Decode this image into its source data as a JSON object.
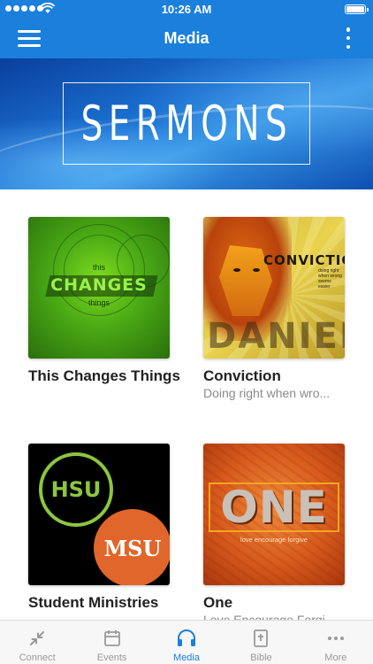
{
  "status_bar": {
    "time": "10:26 AM"
  },
  "header": {
    "title": "Media"
  },
  "banner": {
    "text": "SERMONS"
  },
  "series": [
    {
      "title": "This Changes Things",
      "subtitle": "",
      "art": {
        "line1": "this",
        "line2": "CHANGES",
        "line3": "things"
      }
    },
    {
      "title": "Conviction",
      "subtitle": "Doing right when wro...",
      "art": {
        "word": "CONVICTION",
        "tagline": "doing right when wrong seems easier",
        "overlay": "DANIEL"
      }
    },
    {
      "title": "Student Ministries",
      "subtitle": "",
      "art": {
        "left": "HSU",
        "right": "MSU"
      }
    },
    {
      "title": "One",
      "subtitle": "Love Encourage Forgi...",
      "art": {
        "word": "ONE",
        "tagline": "love  encourage  forgive"
      }
    }
  ],
  "tabs": [
    {
      "label": "Connect",
      "icon": "connect-arrows-icon",
      "active": false
    },
    {
      "label": "Events",
      "icon": "calendar-icon",
      "active": false
    },
    {
      "label": "Media",
      "icon": "headphones-icon",
      "active": true
    },
    {
      "label": "Bible",
      "icon": "bible-icon",
      "active": false
    },
    {
      "label": "More",
      "icon": "more-dots-icon",
      "active": false
    }
  ],
  "colors": {
    "accent": "#1b7fdc",
    "inactive": "#999999",
    "hsu_green": "#8cc63f",
    "msu_orange": "#e0662b"
  }
}
